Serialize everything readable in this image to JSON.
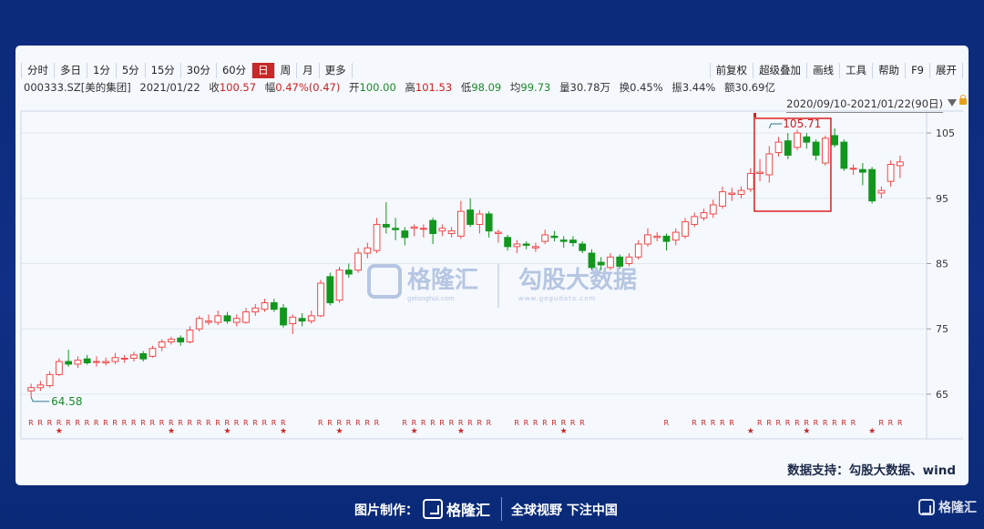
{
  "toolbar": {
    "periods": [
      "分时",
      "多日",
      "1分",
      "5分",
      "15分",
      "30分",
      "60分",
      "日",
      "周",
      "月",
      "更多"
    ],
    "active_period": "日",
    "tools": [
      "前复权",
      "超级叠加",
      "画线",
      "工具",
      "帮助",
      "F9",
      "展开"
    ]
  },
  "quote": {
    "code": "000333.SZ[美的集团]",
    "date": "2021/01/22",
    "close_label": "收",
    "close": "100.57",
    "change_label": "幅",
    "change": "0.47%(0.47)",
    "open_label": "开",
    "open": "100.00",
    "high_label": "高",
    "high": "101.53",
    "low_label": "低",
    "low": "98.09",
    "avg_label": "均",
    "avg": "99.73",
    "volume_label": "量",
    "volume": "30.78万",
    "turnover_label": "换",
    "turnover": "0.45%",
    "amplitude_label": "振",
    "amplitude": "3.44%",
    "amount_label": "额",
    "amount": "30.69亿"
  },
  "range_label": "2020/09/10-2021/01/22(90日)",
  "source_text": "数据支持：勾股大数据、wind",
  "watermark": {
    "brand": "格隆汇",
    "brand_small": "gelonghui.com",
    "brand2": "勾股大数据",
    "brand2_small": "www.gogudata.com"
  },
  "footer": {
    "made_by": "图片制作：",
    "logo_text": "格隆汇",
    "slogan": "全球视野 下注中国",
    "corner_logo": "格隆汇"
  },
  "colors": {
    "up": "#f04848",
    "down": "#12961e",
    "highlight_box": "#e02020",
    "background": "#0d2c7e"
  },
  "chart_data": {
    "type": "candlestick",
    "y_ticks": [
      65,
      75,
      85,
      95,
      105
    ],
    "ylim": [
      61.5,
      107.8
    ],
    "annotation_high": {
      "label": "105.71",
      "value": 105.71,
      "index": 79
    },
    "annotation_low": {
      "label": "64.58",
      "value": 64.58,
      "index": 0
    },
    "highlight_range": [
      78,
      85
    ],
    "candles": [
      {
        "o": 65.5,
        "c": 66.0,
        "h": 66.6,
        "l": 64.6
      },
      {
        "o": 66.0,
        "c": 66.4,
        "h": 67.0,
        "l": 65.5
      },
      {
        "o": 66.3,
        "c": 68.0,
        "h": 68.5,
        "l": 66.0
      },
      {
        "o": 68.0,
        "c": 70.0,
        "h": 70.5,
        "l": 67.8
      },
      {
        "o": 70.0,
        "c": 69.6,
        "h": 71.8,
        "l": 69.2
      },
      {
        "o": 69.6,
        "c": 70.2,
        "h": 70.8,
        "l": 69.0
      },
      {
        "o": 70.4,
        "c": 69.8,
        "h": 71.0,
        "l": 69.5
      },
      {
        "o": 70.0,
        "c": 70.0,
        "h": 70.8,
        "l": 69.2
      },
      {
        "o": 69.8,
        "c": 70.0,
        "h": 70.6,
        "l": 69.4
      },
      {
        "o": 70.0,
        "c": 70.6,
        "h": 71.3,
        "l": 69.6
      },
      {
        "o": 70.5,
        "c": 70.5,
        "h": 71.0,
        "l": 69.8
      },
      {
        "o": 70.5,
        "c": 71.0,
        "h": 71.5,
        "l": 70.0
      },
      {
        "o": 71.2,
        "c": 70.4,
        "h": 71.6,
        "l": 70.0
      },
      {
        "o": 70.8,
        "c": 72.0,
        "h": 72.4,
        "l": 70.6
      },
      {
        "o": 72.2,
        "c": 73.0,
        "h": 73.4,
        "l": 71.6
      },
      {
        "o": 73.0,
        "c": 73.4,
        "h": 73.8,
        "l": 72.6
      },
      {
        "o": 73.6,
        "c": 73.0,
        "h": 74.0,
        "l": 72.4
      },
      {
        "o": 73.0,
        "c": 74.8,
        "h": 75.4,
        "l": 72.8
      },
      {
        "o": 75.0,
        "c": 76.6,
        "h": 77.0,
        "l": 74.6
      },
      {
        "o": 76.0,
        "c": 76.2,
        "h": 77.2,
        "l": 75.6
      },
      {
        "o": 76.0,
        "c": 77.0,
        "h": 77.8,
        "l": 75.6
      },
      {
        "o": 77.0,
        "c": 76.2,
        "h": 77.6,
        "l": 75.8
      },
      {
        "o": 76.0,
        "c": 76.6,
        "h": 77.2,
        "l": 75.4
      },
      {
        "o": 76.0,
        "c": 77.6,
        "h": 78.2,
        "l": 75.8
      },
      {
        "o": 77.6,
        "c": 78.2,
        "h": 78.8,
        "l": 77.0
      },
      {
        "o": 78.0,
        "c": 79.0,
        "h": 79.6,
        "l": 77.6
      },
      {
        "o": 79.0,
        "c": 78.0,
        "h": 79.6,
        "l": 77.6
      },
      {
        "o": 78.2,
        "c": 75.6,
        "h": 78.8,
        "l": 75.2
      },
      {
        "o": 75.8,
        "c": 76.8,
        "h": 77.2,
        "l": 74.2
      },
      {
        "o": 76.6,
        "c": 76.2,
        "h": 77.4,
        "l": 75.4
      },
      {
        "o": 76.2,
        "c": 77.0,
        "h": 77.8,
        "l": 75.8
      },
      {
        "o": 77.0,
        "c": 82.0,
        "h": 82.5,
        "l": 76.8
      },
      {
        "o": 83.0,
        "c": 79.0,
        "h": 83.6,
        "l": 78.6
      },
      {
        "o": 79.4,
        "c": 84.0,
        "h": 84.5,
        "l": 79.0
      },
      {
        "o": 84.0,
        "c": 83.4,
        "h": 85.0,
        "l": 82.8
      },
      {
        "o": 84.0,
        "c": 86.6,
        "h": 87.4,
        "l": 83.6
      },
      {
        "o": 86.6,
        "c": 87.4,
        "h": 88.2,
        "l": 85.8
      },
      {
        "o": 87.0,
        "c": 91.0,
        "h": 92.0,
        "l": 86.6
      },
      {
        "o": 91.0,
        "c": 90.6,
        "h": 94.4,
        "l": 89.6
      },
      {
        "o": 90.4,
        "c": 90.2,
        "h": 92.0,
        "l": 88.6
      },
      {
        "o": 90.0,
        "c": 89.0,
        "h": 90.6,
        "l": 87.8
      },
      {
        "o": 90.4,
        "c": 90.6,
        "h": 91.0,
        "l": 89.2
      },
      {
        "o": 90.4,
        "c": 90.4,
        "h": 91.0,
        "l": 89.0
      },
      {
        "o": 91.6,
        "c": 89.6,
        "h": 92.0,
        "l": 88.0
      },
      {
        "o": 90.0,
        "c": 90.4,
        "h": 91.0,
        "l": 89.2
      },
      {
        "o": 89.6,
        "c": 90.0,
        "h": 90.6,
        "l": 89.0
      },
      {
        "o": 89.2,
        "c": 93.0,
        "h": 94.6,
        "l": 88.8
      },
      {
        "o": 93.2,
        "c": 91.0,
        "h": 95.0,
        "l": 90.6
      },
      {
        "o": 91.0,
        "c": 92.6,
        "h": 93.2,
        "l": 89.6
      },
      {
        "o": 92.6,
        "c": 90.0,
        "h": 93.0,
        "l": 89.0
      },
      {
        "o": 89.6,
        "c": 89.8,
        "h": 90.2,
        "l": 88.2
      },
      {
        "o": 89.0,
        "c": 87.6,
        "h": 89.4,
        "l": 87.0
      },
      {
        "o": 87.6,
        "c": 88.0,
        "h": 88.6,
        "l": 86.6
      },
      {
        "o": 88.0,
        "c": 87.8,
        "h": 88.4,
        "l": 87.2
      },
      {
        "o": 87.4,
        "c": 87.6,
        "h": 88.2,
        "l": 86.8
      },
      {
        "o": 88.4,
        "c": 89.4,
        "h": 90.2,
        "l": 88.0
      },
      {
        "o": 89.2,
        "c": 89.0,
        "h": 90.0,
        "l": 88.4
      },
      {
        "o": 88.6,
        "c": 88.4,
        "h": 89.2,
        "l": 87.4
      },
      {
        "o": 88.6,
        "c": 88.2,
        "h": 89.2,
        "l": 87.6
      },
      {
        "o": 88.0,
        "c": 87.0,
        "h": 88.4,
        "l": 86.6
      },
      {
        "o": 86.6,
        "c": 84.4,
        "h": 87.2,
        "l": 84.0
      },
      {
        "o": 85.2,
        "c": 84.8,
        "h": 86.0,
        "l": 84.0
      },
      {
        "o": 84.4,
        "c": 86.0,
        "h": 86.6,
        "l": 84.0
      },
      {
        "o": 86.0,
        "c": 84.6,
        "h": 86.4,
        "l": 84.2
      },
      {
        "o": 85.0,
        "c": 86.0,
        "h": 86.6,
        "l": 84.6
      },
      {
        "o": 86.0,
        "c": 88.0,
        "h": 88.6,
        "l": 85.6
      },
      {
        "o": 88.0,
        "c": 89.4,
        "h": 90.4,
        "l": 87.6
      },
      {
        "o": 89.0,
        "c": 89.2,
        "h": 89.8,
        "l": 88.4
      },
      {
        "o": 89.2,
        "c": 88.4,
        "h": 89.6,
        "l": 87.0
      },
      {
        "o": 88.6,
        "c": 89.8,
        "h": 90.4,
        "l": 87.8
      },
      {
        "o": 89.2,
        "c": 91.4,
        "h": 92.0,
        "l": 88.8
      },
      {
        "o": 91.0,
        "c": 92.2,
        "h": 92.8,
        "l": 90.6
      },
      {
        "o": 92.0,
        "c": 92.8,
        "h": 93.4,
        "l": 91.6
      },
      {
        "o": 92.6,
        "c": 94.0,
        "h": 94.8,
        "l": 92.0
      },
      {
        "o": 93.8,
        "c": 96.0,
        "h": 96.8,
        "l": 93.4
      },
      {
        "o": 95.6,
        "c": 95.8,
        "h": 96.6,
        "l": 94.6
      },
      {
        "o": 95.6,
        "c": 96.2,
        "h": 96.8,
        "l": 95.0
      },
      {
        "o": 96.4,
        "c": 98.8,
        "h": 99.6,
        "l": 96.0
      },
      {
        "o": 98.8,
        "c": 99.0,
        "h": 101.0,
        "l": 97.6
      },
      {
        "o": 98.6,
        "c": 101.8,
        "h": 103.0,
        "l": 97.4
      },
      {
        "o": 102.0,
        "c": 103.6,
        "h": 104.4,
        "l": 101.4
      },
      {
        "o": 103.8,
        "c": 101.6,
        "h": 105.0,
        "l": 101.0
      },
      {
        "o": 102.8,
        "c": 105.0,
        "h": 105.5,
        "l": 102.4
      },
      {
        "o": 104.4,
        "c": 103.6,
        "h": 105.0,
        "l": 102.6
      },
      {
        "o": 103.6,
        "c": 101.6,
        "h": 104.0,
        "l": 100.8
      },
      {
        "o": 100.4,
        "c": 104.2,
        "h": 104.6,
        "l": 100.0
      },
      {
        "o": 104.6,
        "c": 103.2,
        "h": 105.71,
        "l": 102.8
      },
      {
        "o": 103.6,
        "c": 99.6,
        "h": 104.0,
        "l": 99.2
      },
      {
        "o": 99.6,
        "c": 99.6,
        "h": 100.2,
        "l": 98.6
      },
      {
        "o": 99.4,
        "c": 99.0,
        "h": 100.4,
        "l": 97.0
      },
      {
        "o": 99.4,
        "c": 94.6,
        "h": 99.8,
        "l": 94.2
      },
      {
        "o": 95.8,
        "c": 96.2,
        "h": 96.8,
        "l": 95.0
      },
      {
        "o": 97.6,
        "c": 100.2,
        "h": 100.8,
        "l": 96.8
      },
      {
        "o": 100.0,
        "c": 100.57,
        "h": 101.53,
        "l": 98.09
      }
    ],
    "event_markers": [
      "R",
      "★"
    ]
  }
}
